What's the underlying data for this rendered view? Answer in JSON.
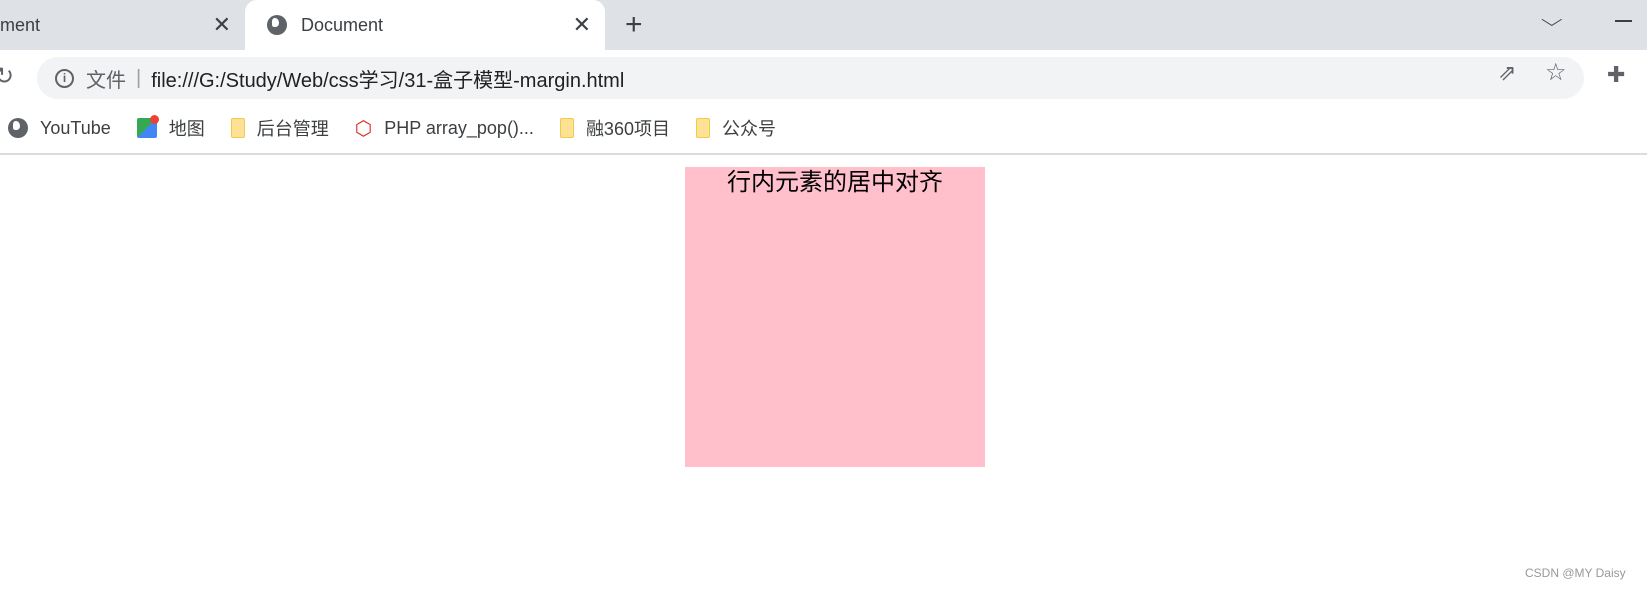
{
  "tabs": [
    {
      "label": "ment",
      "close": "✕"
    },
    {
      "label": "Document",
      "close": "✕",
      "active": true
    }
  ],
  "new_tab": "+",
  "address": {
    "scheme": "文件",
    "separator": "|",
    "url": "file:///G:/Study/Web/css学习/31-盒子模型-margin.html"
  },
  "bookmarks": [
    {
      "label": "YouTube",
      "icon": "globe-icon"
    },
    {
      "label": "地图",
      "icon": "maps-icon"
    },
    {
      "label": "后台管理",
      "icon": "folder-icon"
    },
    {
      "label": "PHP array_pop()...",
      "icon": "php-icon"
    },
    {
      "label": "融360项目",
      "icon": "folder-icon"
    },
    {
      "label": "公众号",
      "icon": "folder-icon"
    }
  ],
  "page": {
    "box_text": "行内元素的居中对齐",
    "box_color": "#ffc0cb"
  },
  "watermark": "CSDN @MY Daisy"
}
